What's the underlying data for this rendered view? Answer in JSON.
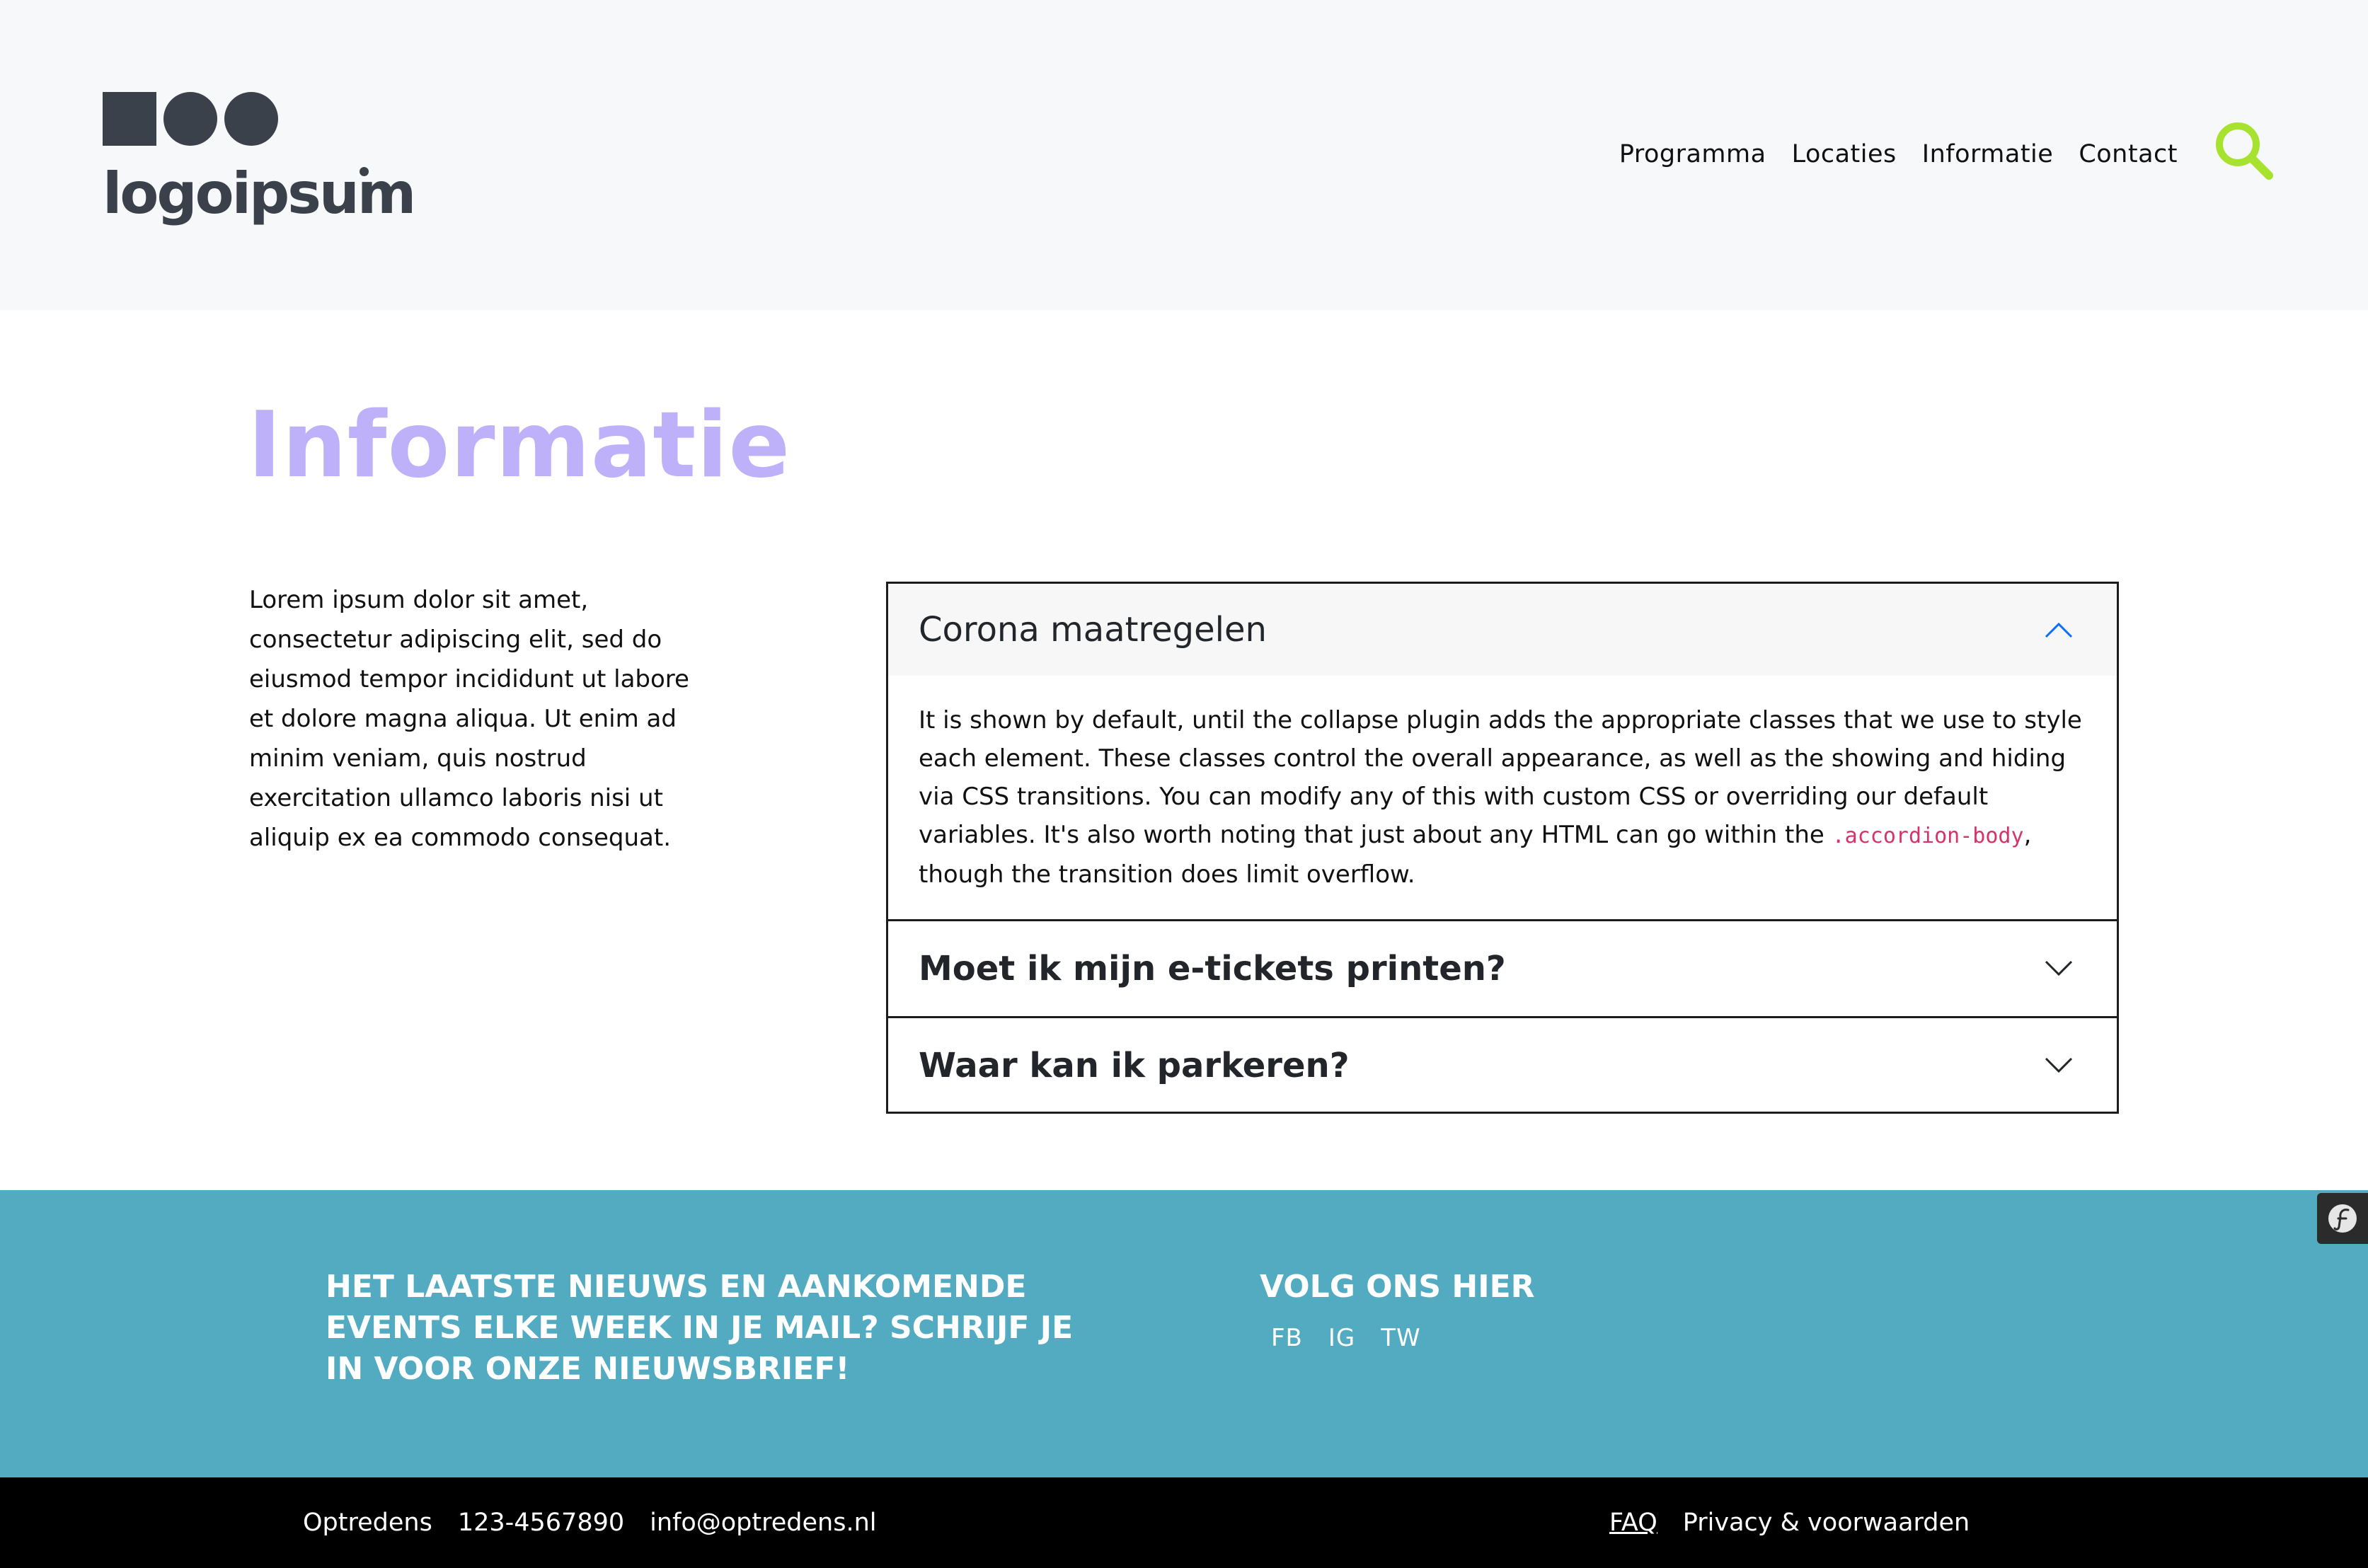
{
  "colors": {
    "header_bg": "#f7f8fa",
    "logo": "#3a414b",
    "accent_green": "#a6e22e",
    "title_purple": "#bfb0fa",
    "newsletter_bg": "#52abc0",
    "bottom_bar_bg": "#000000",
    "code_pink": "#d6336c",
    "chevron_open": "#0d6efd"
  },
  "header": {
    "logo_text": "logoipsum",
    "nav": [
      "Programma",
      "Locaties",
      "Informatie",
      "Contact"
    ],
    "search_icon": "search-icon"
  },
  "main": {
    "title": "Informatie",
    "intro": "Lorem ipsum dolor sit amet, consectetur adipiscing elit, sed do eiusmod tempor incididunt ut labore et dolore magna aliqua. Ut enim ad minim veniam, quis nostrud exercitation ullamco laboris nisi ut aliquip ex ea commodo consequat."
  },
  "accordion": {
    "items": [
      {
        "title": "Corona maatregelen",
        "expanded": true,
        "body_before_code": "It is shown by default, until the collapse plugin adds the appropriate classes that we use to style each element. These classes control the overall appearance, as well as the showing and hiding via CSS transitions. You can modify any of this with custom CSS or overriding our default variables. It's also worth noting that just about any HTML can go within the ",
        "body_code": ".accordion-body",
        "body_after_code": ", though the transition does limit overflow."
      },
      {
        "title": "Moet ik mijn e-tickets printen?",
        "expanded": false
      },
      {
        "title": "Waar kan ik parkeren?",
        "expanded": false
      }
    ]
  },
  "footer": {
    "newsletter_text": "HET LAATSTE NIEUWS EN AANKOMENDE EVENTS ELKE WEEK IN JE MAIL? SCHRIJF JE IN VOOR ONZE NIEUWSBRIEF!",
    "follow_title": "VOLG ONS HIER",
    "socials": [
      "FB",
      "IG",
      "TW"
    ],
    "side_badge_icon": "symfony-icon"
  },
  "bottom_bar": {
    "company": "Optredens",
    "phone": "123-4567890",
    "email": "info@optredens.nl",
    "faq": "FAQ",
    "privacy": "Privacy & voorwaarden"
  }
}
